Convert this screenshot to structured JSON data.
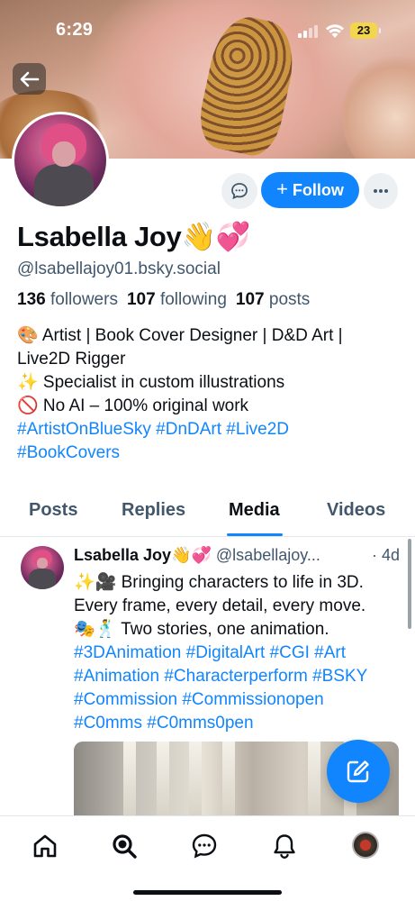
{
  "status_bar": {
    "time": "6:29",
    "battery": "23"
  },
  "profile": {
    "display_name": "Lsabella Joy👋💞",
    "handle": "@lsabellajoy01.bsky.social",
    "followers_count": "136",
    "followers_label": "followers",
    "following_count": "107",
    "following_label": "following",
    "posts_count": "107",
    "posts_label": "posts",
    "bio_lines": [
      "🎨 Artist | Book Cover Designer | D&D Art |",
      "Live2D Rigger",
      "✨ Specialist in custom illustrations",
      "🚫 No AI – 100% original work",
      "#ArtistOnBlueSky #DnDArt #Live2D",
      "#BookCovers"
    ]
  },
  "actions": {
    "follow_label": "Follow"
  },
  "tabs": [
    {
      "label": "Posts",
      "active": false
    },
    {
      "label": "Replies",
      "active": false
    },
    {
      "label": "Media",
      "active": true
    },
    {
      "label": "Videos",
      "active": false
    }
  ],
  "post": {
    "author": "Lsabella Joy👋💞",
    "handle": "@lsabellajoy...",
    "time": "· 4d",
    "lines": [
      "✨🎥 Bringing characters to life in 3D.",
      "Every frame, every detail, every move.",
      "🎭🕺 Two stories, one animation.",
      "#3DAnimation #DigitalArt #CGI #Art",
      "#Animation #Characterperform #BSKY",
      "#Commission #Commissionopen",
      "#C0mms #C0mms0pen"
    ]
  },
  "bottom_nav": [
    "home-icon",
    "search-icon",
    "chat-icon",
    "bell-icon",
    "profile-avatar"
  ],
  "colors": {
    "accent": "#1185fe",
    "muted_text": "#42576c",
    "battery": "#f3d64b"
  }
}
